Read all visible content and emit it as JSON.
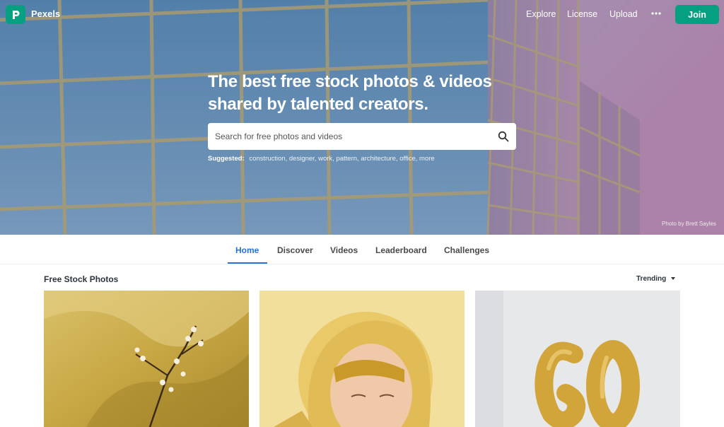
{
  "app": {
    "name": "Pexels"
  },
  "nav": {
    "links": [
      "Explore",
      "License",
      "Upload"
    ],
    "more_icon": "more-dots-icon",
    "join_label": "Join"
  },
  "hero": {
    "headline_line1": "The best free stock photos & videos",
    "headline_line2": "shared by talented creators.",
    "search_placeholder": "Search for free photos and videos",
    "search_icon": "search-icon",
    "suggested_label": "Suggested:",
    "suggestions": [
      "construction,",
      "designer,",
      "work,",
      "pattern,",
      "architecture,",
      "office,",
      "more"
    ],
    "credit": "Photo by Brett Sayles"
  },
  "tabs": [
    "Home",
    "Discover",
    "Videos",
    "Leaderboard",
    "Challenges"
  ],
  "active_tab": "Home",
  "feed": {
    "title": "Free Stock Photos",
    "sort_label": "Trending",
    "photos": [
      "golden-branch-photo",
      "golden-mask-portrait-photo",
      "gold-60-balloons-photo"
    ]
  },
  "colors": {
    "brand": "#05a081",
    "active_tab": "#2b6fd6",
    "text_dark": "#2c343e"
  }
}
